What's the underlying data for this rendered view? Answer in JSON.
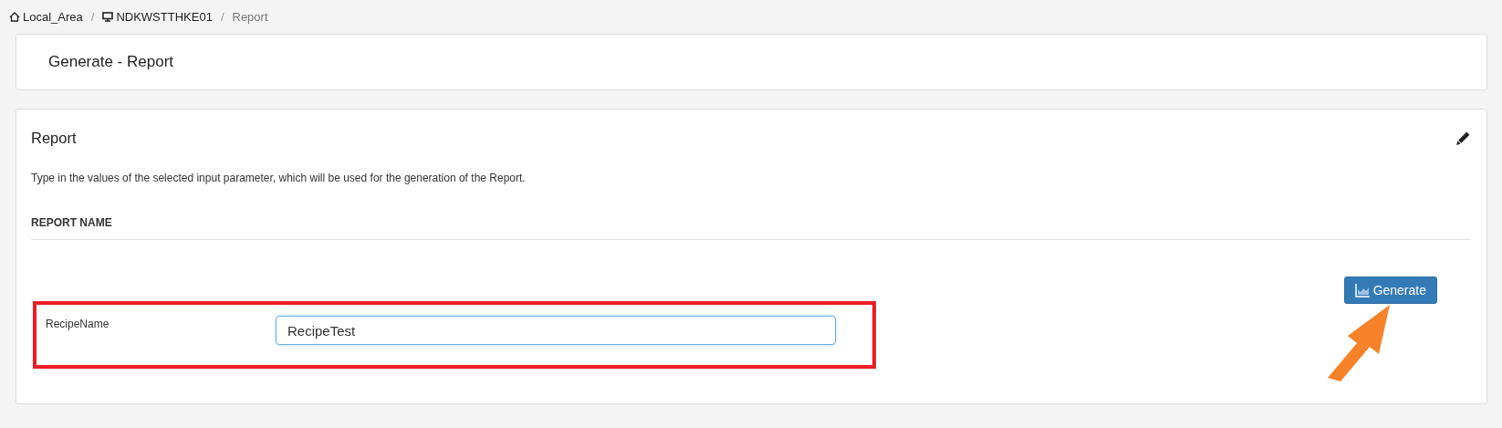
{
  "breadcrumb_separator": "/",
  "breadcrumb": [
    {
      "label": "Local_Area",
      "kind": "home",
      "current": false
    },
    {
      "label": "NDKWSTTHKE01",
      "kind": "device",
      "current": false
    },
    {
      "label": "Report",
      "kind": "page",
      "current": true
    }
  ],
  "page_title": "Generate - Report",
  "report": {
    "title": "Report",
    "description": "Type in the values of the selected input parameter, which will be used for the generation of the Report.",
    "section_heading": "REPORT NAME",
    "fields": [
      {
        "label": "RecipeName",
        "value": "RecipeTest",
        "highlighted": true
      }
    ],
    "generate_button": "Generate"
  }
}
